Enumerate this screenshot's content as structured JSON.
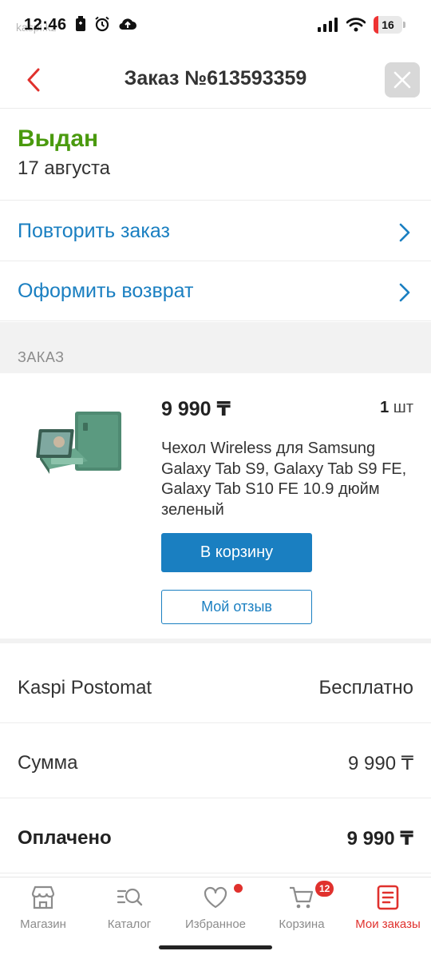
{
  "status_bar": {
    "time": "12:46",
    "site": "kaspi.kz",
    "battery": "16"
  },
  "header": {
    "title": "Заказ №613593359"
  },
  "order_status": {
    "label": "Выдан",
    "date": "17 августа",
    "status_color": "#4a9a0e"
  },
  "actions": {
    "repeat": "Повторить заказ",
    "return": "Оформить возврат"
  },
  "section": {
    "title": "ЗАКАЗ"
  },
  "product": {
    "price": "9 990 ₸",
    "qty_number": "1",
    "qty_unit": "шт",
    "name": "Чехол Wireless для Samsung Galaxy Tab S9, Galaxy Tab S9 FE, Galaxy Tab S10 FE 10.9 дюйм зеленый",
    "cart_button": "В корзину",
    "review_button": "Мой отзыв"
  },
  "summary": {
    "delivery_label": "Kaspi Postomat",
    "delivery_value": "Бесплатно",
    "sum_label": "Сумма",
    "sum_value": "9 990 ₸",
    "paid_label": "Оплачено",
    "paid_value": "9 990 ₸"
  },
  "nav": {
    "items": [
      {
        "label": "Магазин",
        "icon": "shop-icon"
      },
      {
        "label": "Каталог",
        "icon": "catalog-search-icon"
      },
      {
        "label": "Избранное",
        "icon": "heart-icon"
      },
      {
        "label": "Корзина",
        "icon": "cart-icon"
      },
      {
        "label": "Мои заказы",
        "icon": "orders-icon"
      }
    ],
    "cart_badge": "12",
    "active_color": "#e0312d"
  },
  "colors": {
    "accent": "#1a7fc1",
    "back_arrow": "#e0312d"
  }
}
